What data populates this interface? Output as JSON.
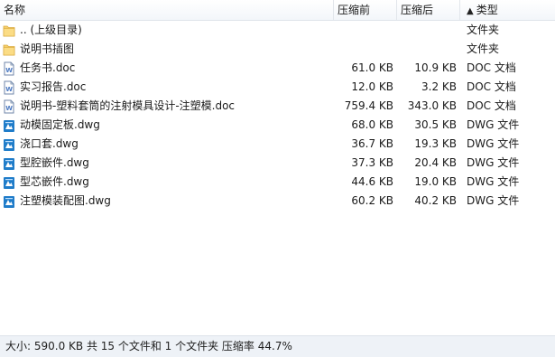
{
  "columns": {
    "name": "名称",
    "size": "压缩前",
    "compressed": "压缩后",
    "type": "类型",
    "sort_indicator": "▲"
  },
  "files": [
    {
      "icon": "folder-up-icon",
      "name": ".. (上级目录)",
      "size": "",
      "compressed": "",
      "type": "文件夹"
    },
    {
      "icon": "folder-icon",
      "name": "说明书插图",
      "size": "",
      "compressed": "",
      "type": "文件夹"
    },
    {
      "icon": "doc-file-icon",
      "name": "任务书.doc",
      "size": "61.0 KB",
      "compressed": "10.9 KB",
      "type": "DOC 文档"
    },
    {
      "icon": "doc-file-icon",
      "name": "实习报告.doc",
      "size": "12.0 KB",
      "compressed": "3.2 KB",
      "type": "DOC 文档"
    },
    {
      "icon": "doc-file-icon",
      "name": "说明书-塑料套筒的注射模具设计-注塑模.doc",
      "size": "759.4 KB",
      "compressed": "343.0 KB",
      "type": "DOC 文档"
    },
    {
      "icon": "dwg-file-icon",
      "name": "动模固定板.dwg",
      "size": "68.0 KB",
      "compressed": "30.5 KB",
      "type": "DWG 文件"
    },
    {
      "icon": "dwg-file-icon",
      "name": "浇口套.dwg",
      "size": "36.7 KB",
      "compressed": "19.3 KB",
      "type": "DWG 文件"
    },
    {
      "icon": "dwg-file-icon",
      "name": "型腔嵌件.dwg",
      "size": "37.3 KB",
      "compressed": "20.4 KB",
      "type": "DWG 文件"
    },
    {
      "icon": "dwg-file-icon",
      "name": "型芯嵌件.dwg",
      "size": "44.6 KB",
      "compressed": "19.0 KB",
      "type": "DWG 文件"
    },
    {
      "icon": "dwg-file-icon",
      "name": "注塑模装配图.dwg",
      "size": "60.2 KB",
      "compressed": "40.2 KB",
      "type": "DWG 文件"
    }
  ],
  "status_text": "大小: 590.0 KB 共 15 个文件和 1 个文件夹 压缩率 44.7%",
  "colors": {
    "folder": "#f5cf6c",
    "doc_blue": "#4a78c2",
    "dwg_blue": "#1f7cc9",
    "status_bg": "#eef2f7"
  }
}
